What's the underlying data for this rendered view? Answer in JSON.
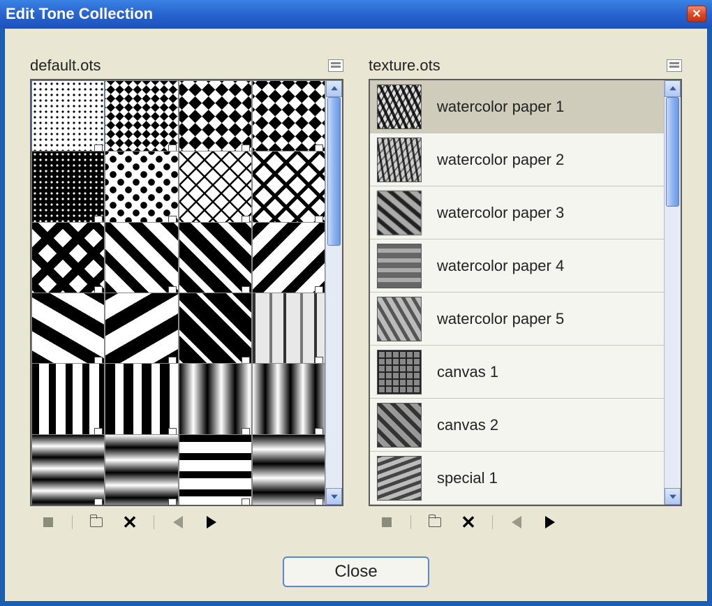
{
  "title": "Edit Tone Collection",
  "close_label": "Close",
  "left": {
    "filename": "default.ots",
    "selected_index": 0,
    "scroll": {
      "thumb_top_pct": 0,
      "thumb_height_pct": 38
    },
    "swatches": [
      {
        "name": "fine-dots",
        "css": "pat-dots-fine"
      },
      {
        "name": "checker-small",
        "css": "pat-check-s",
        "wrap": true
      },
      {
        "name": "checker-mid",
        "css": "pat-check-m",
        "wrap": true
      },
      {
        "name": "checker-mid-inv",
        "css": "pat-check-mi",
        "wrap": true
      },
      {
        "name": "fine-dots-inv",
        "css": "pat-dots-finei"
      },
      {
        "name": "big-dots",
        "css": "pat-dots-big"
      },
      {
        "name": "diamond-grid",
        "css": "pat-diamondsq"
      },
      {
        "name": "diamond-grid-lg",
        "css": "pat-diamondsq2"
      },
      {
        "name": "cross-hatch-lg",
        "css": "pat-cross-big"
      },
      {
        "name": "diag-right",
        "css": "pat-diag-r"
      },
      {
        "name": "diag-right-inv",
        "css": "pat-diag-r-inv"
      },
      {
        "name": "diag-left",
        "css": "pat-diag-l"
      },
      {
        "name": "diag-wide-r",
        "css": "pat-diag-wide"
      },
      {
        "name": "diag-wide-l",
        "css": "pat-diag-wide2"
      },
      {
        "name": "diag-black-wide",
        "css": "pat-diag-blk"
      },
      {
        "name": "columns-soft",
        "css": "pat-cols-soft"
      },
      {
        "name": "columns-a",
        "css": "pat-cols"
      },
      {
        "name": "columns-b",
        "css": "pat-cols-b"
      },
      {
        "name": "columns-grad-a",
        "css": "pat-cols-grad"
      },
      {
        "name": "columns-grad-b",
        "css": "pat-cols-grad2"
      },
      {
        "name": "rows-grad-a",
        "css": "pat-rows-grad"
      },
      {
        "name": "rows-grad-b",
        "css": "pat-rows-grad2"
      },
      {
        "name": "rows-solid",
        "css": "pat-rows"
      },
      {
        "name": "rows-glow",
        "css": "pat-rows-glow"
      }
    ]
  },
  "right": {
    "filename": "texture.ots",
    "selected_index": 0,
    "scroll": {
      "thumb_top_pct": 0,
      "thumb_height_pct": 28
    },
    "items": [
      {
        "label": "watercolor paper 1",
        "tex": "tex1"
      },
      {
        "label": "watercolor paper 2",
        "tex": "tex2"
      },
      {
        "label": "watercolor paper 3",
        "tex": "tex3"
      },
      {
        "label": "watercolor paper 4",
        "tex": "tex4"
      },
      {
        "label": "watercolor paper 5",
        "tex": "tex5"
      },
      {
        "label": "canvas 1",
        "tex": "tex6"
      },
      {
        "label": "canvas 2",
        "tex": "tex7"
      },
      {
        "label": "special 1",
        "tex": "tex8"
      }
    ]
  },
  "toolbar": {
    "stop_tip": "Stop",
    "open_tip": "Open",
    "delete_tip": "Delete",
    "prev_tip": "Previous",
    "next_tip": "Next"
  }
}
